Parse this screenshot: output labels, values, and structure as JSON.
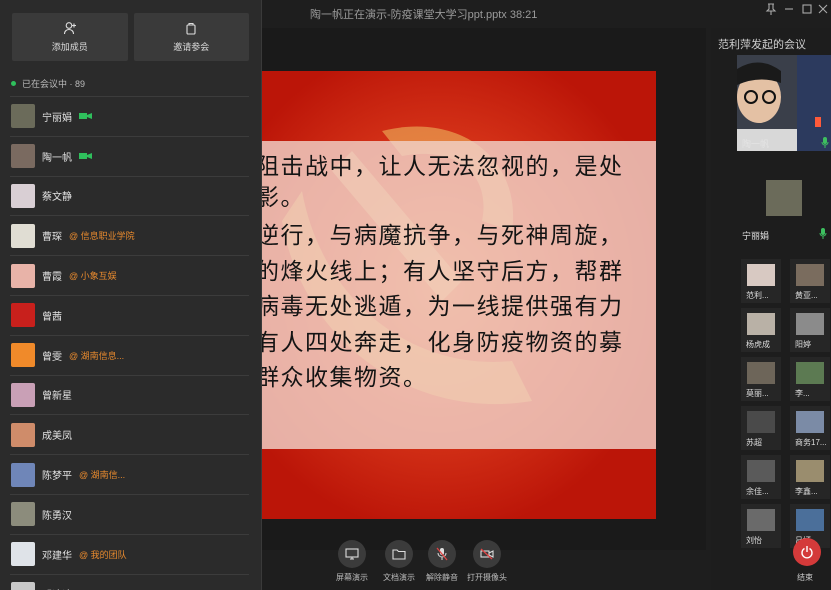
{
  "window_title": "陶一帆正在演示-防疫课堂大学习ppt.pptx 38:21",
  "panel": {
    "add_member": "添加成员",
    "invite": "邀请参会",
    "in_meeting": "已在会议中 · 89"
  },
  "participants": [
    {
      "name": "宁丽娟",
      "org": "",
      "cam": true,
      "color": "#6b6b5a"
    },
    {
      "name": "陶一帆",
      "org": "",
      "cam": true,
      "color": "#7a6a60"
    },
    {
      "name": "蔡文静",
      "org": "",
      "cam": false,
      "color": "#d9cfd4"
    },
    {
      "name": "曹琛",
      "org": "@ 信息职业学院",
      "cam": false,
      "color": "#e0ddd3"
    },
    {
      "name": "曹霞",
      "org": "@ 小象互娱",
      "cam": false,
      "color": "#e8b3a8"
    },
    {
      "name": "曾茜",
      "org": "",
      "cam": false,
      "color": "#c8201c"
    },
    {
      "name": "曾雯",
      "org": "@ 湖南信息...",
      "cam": false,
      "color": "#f08a2a"
    },
    {
      "name": "曾新星",
      "org": "",
      "cam": false,
      "color": "#c9a0b6"
    },
    {
      "name": "成美凤",
      "org": "",
      "cam": false,
      "color": "#cf8c6a"
    },
    {
      "name": "陈梦平",
      "org": "@ 湖南信...",
      "cam": false,
      "color": "#6f86b8"
    },
    {
      "name": "陈勇汉",
      "org": "",
      "cam": false,
      "color": "#8c8c7c"
    },
    {
      "name": "邓建华",
      "org": "@ 我的团队",
      "cam": false,
      "color": "#dfe3e8"
    },
    {
      "name": "邓迪迪",
      "org": "",
      "cam": false,
      "color": "#c9c9c9"
    }
  ],
  "slide": {
    "lines": [
      "阻击战中，让人无法忽视的，是处",
      "影。",
      "逆行，与病魔抗争，与死神周旋，",
      "的烽火线上；有人坚守后方，帮群",
      "病毒无处逃遁，为一线提供强有力",
      "有人四处奔走，化身防疫物资的募",
      "群众收集物资。"
    ]
  },
  "toolbar": {
    "screen_share": "屏幕演示",
    "doc_share": "文档演示",
    "unmute": "解除静音",
    "camera": "打开摄像头"
  },
  "right": {
    "title": "范利萍发起的会议",
    "speaker1": "陶一帆",
    "speaker2": "宁丽娟",
    "thumbs": [
      {
        "name": "范利...",
        "color": "#d8c9c2"
      },
      {
        "name": "黄亚...",
        "color": "#7a6c5e"
      },
      {
        "name": "杨虎成",
        "color": "#b9b1a6"
      },
      {
        "name": "阳婷",
        "color": "#8b8b8b"
      },
      {
        "name": "莫丽...",
        "color": "#6d6559"
      },
      {
        "name": "李...",
        "color": "#5c7a52"
      },
      {
        "name": "苏超",
        "color": "#4a4a4a"
      },
      {
        "name": "商务17...",
        "color": "#7b8ba6"
      },
      {
        "name": "余佳...",
        "color": "#5a5a5a"
      },
      {
        "name": "李鑫...",
        "color": "#9a8d6e"
      },
      {
        "name": "刘怡",
        "color": "#6a6a6a"
      },
      {
        "name": "吕嫣...",
        "color": "#4b6f9a"
      }
    ],
    "end_label": "结束"
  }
}
